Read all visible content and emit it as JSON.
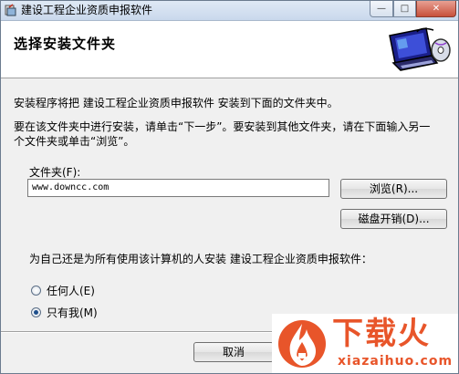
{
  "window": {
    "title": "建设工程企业资质申报软件",
    "minimize_glyph": "—",
    "maximize_glyph": "□",
    "close_glyph": "✕"
  },
  "header": {
    "heading": "选择安装文件夹"
  },
  "body": {
    "line1": "安装程序将把 建设工程企业资质申报软件  安装到下面的文件夹中。",
    "line2": "要在该文件夹中进行安装，请单击“下一步”。要安装到其他文件夹，请在下面输入另一",
    "line3": "个文件夹或单击“浏览”。",
    "folder_label": "文件夹(F):",
    "folder_value": "www.downcc.com",
    "browse_label": "浏览(R)...",
    "disk_cost_label": "磁盘开销(D)...",
    "question": "为自己还是为所有使用该计算机的人安装 建设工程企业资质申报软件：",
    "options": [
      {
        "label": "任何人(E)",
        "selected": false
      },
      {
        "label": "只有我(M)",
        "selected": true
      }
    ]
  },
  "footer": {
    "cancel_label": "取消"
  },
  "watermark": {
    "text": "下载火",
    "url": "xiazaihuo.com"
  },
  "colors": {
    "brand_orange": "#e8552a",
    "title_bar": "#c9d8ec"
  }
}
